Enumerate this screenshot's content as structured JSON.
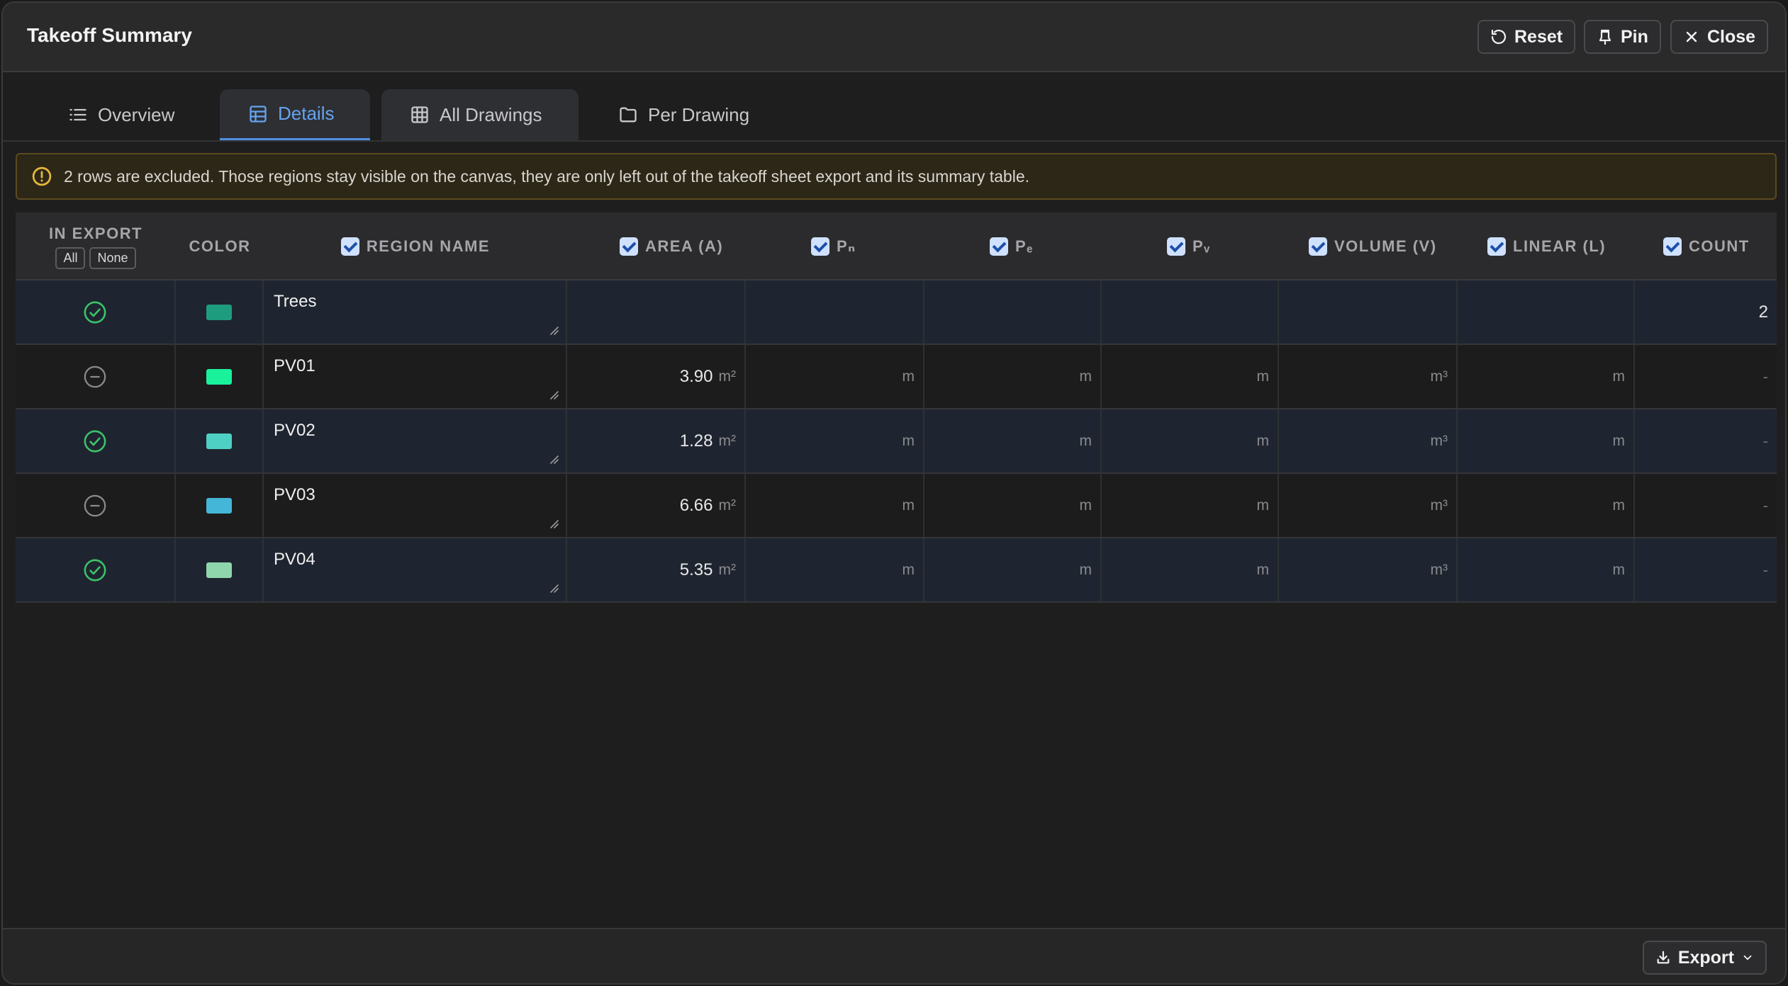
{
  "window": {
    "title": "Takeoff Summary"
  },
  "header_buttons": {
    "reset": "Reset",
    "pin": "Pin",
    "close": "Close"
  },
  "tabs": [
    {
      "label": "Overview",
      "icon": "list-icon"
    },
    {
      "label": "Details",
      "icon": "table-icon",
      "active": true
    },
    {
      "label": "All Drawings",
      "icon": "grid-icon"
    },
    {
      "label": "Per Drawing",
      "icon": "folder-icon"
    }
  ],
  "notice": {
    "text": "2 rows are excluded. Those regions stay visible on the canvas, they are only left out of the takeoff sheet export and its summary table.",
    "icon": "warning-circle-icon"
  },
  "columns": {
    "in_export": "IN EXPORT",
    "all_btn": "All",
    "none_btn": "None",
    "color": "COLOR",
    "region_name": "REGION NAME",
    "area": "AREA (A)",
    "pn": "Pₙ",
    "pe": "Pₑ",
    "pv": "Pᵥ",
    "volume": "VOLUME (V)",
    "linear": "LINEAR (L)",
    "count": "COUNT"
  },
  "rows": [
    {
      "included": true,
      "color": "#1e9d7e",
      "name": "Trees",
      "area": "",
      "area_unit": "",
      "pn": "",
      "pe": "",
      "pv": "",
      "volume": "",
      "linear": "",
      "count": "2"
    },
    {
      "included": false,
      "color": "#19f29b",
      "name": "PV01",
      "area": "3.90",
      "area_unit": "m²",
      "pn": "m",
      "pe": "m",
      "pv": "m",
      "volume": "m³",
      "linear": "m",
      "count": "-"
    },
    {
      "included": true,
      "color": "#4fd0c4",
      "name": "PV02",
      "area": "1.28",
      "area_unit": "m²",
      "pn": "m",
      "pe": "m",
      "pv": "m",
      "volume": "m³",
      "linear": "m",
      "count": "-"
    },
    {
      "included": false,
      "color": "#44b6d8",
      "name": "PV03",
      "area": "6.66",
      "area_unit": "m²",
      "pn": "m",
      "pe": "m",
      "pv": "m",
      "volume": "m³",
      "linear": "m",
      "count": "-"
    },
    {
      "included": true,
      "color": "#8fd6ad",
      "name": "PV04",
      "area": "5.35",
      "area_unit": "m²",
      "pn": "m",
      "pe": "m",
      "pv": "m",
      "volume": "m³",
      "linear": "m",
      "count": "-"
    }
  ],
  "footer": {
    "export": "Export"
  },
  "colors": {
    "accent": "#66a3ee",
    "included": "#3bc46b",
    "excluded": "#8a8a8e",
    "warning": "#e6b83a"
  }
}
